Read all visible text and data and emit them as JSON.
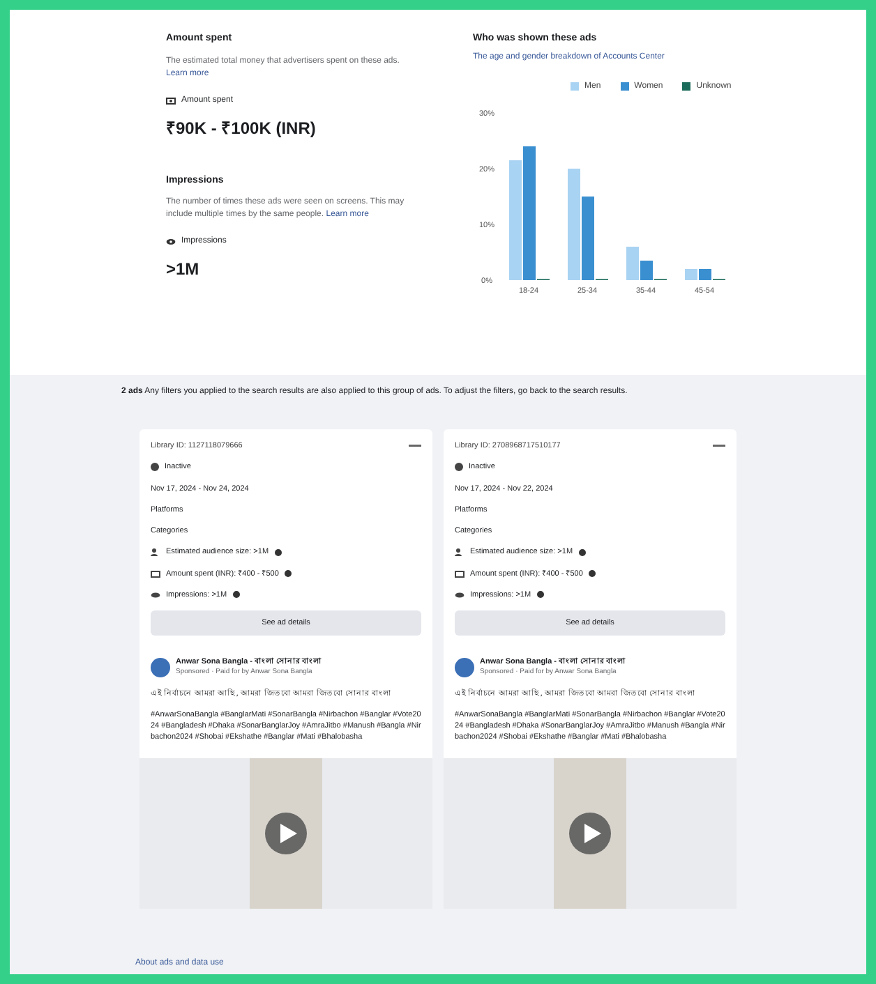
{
  "spend": {
    "title": "Amount spent",
    "description": "The estimated total money that advertisers spent on these ads.",
    "link": "Learn more",
    "label": "Amount spent",
    "value": "₹90K - ₹100K (INR)"
  },
  "impressions": {
    "title": "Impressions",
    "description": "The number of times these ads were seen on screens. This may include multiple times by the same people.",
    "link": "Learn more",
    "label": "Impressions",
    "value": ">1M"
  },
  "audience": {
    "title": "Who was shown these ads",
    "description": "The age and gender breakdown of Accounts Center",
    "chart_data": {
      "type": "bar",
      "categories": [
        "18-24",
        "25-34",
        "35-44",
        "45-54"
      ],
      "series": [
        {
          "name": "Men",
          "color": "#a9d3f2",
          "values": [
            21.5,
            20,
            6,
            2
          ]
        },
        {
          "name": "Women",
          "color": "#3a8fd0",
          "values": [
            24,
            15,
            3.5,
            2
          ]
        },
        {
          "name": "Unknown",
          "color": "#1b6b5a",
          "values": [
            0,
            0,
            0,
            0
          ]
        }
      ],
      "ylim": [
        0,
        30
      ],
      "yticks": [
        {
          "value": 0,
          "label": "0%"
        },
        {
          "value": 10,
          "label": "10%"
        },
        {
          "value": 20,
          "label": "20%"
        },
        {
          "value": 30,
          "label": "30%"
        }
      ]
    }
  },
  "summary": {
    "count": "2 ads",
    "text": "Any filters you applied to the search results are also applied to this group of ads. To adjust the filters, go back to the search results."
  },
  "ads": [
    {
      "library_id": "Library ID: 1127118079666",
      "status": "Inactive",
      "dates": "Nov 17, 2024 - Nov 24, 2024",
      "platforms": "Platforms",
      "categories": "Categories",
      "audience": "Estimated audience size: >1M",
      "spent": "Amount spent (INR): ₹400 - ₹500",
      "impressions": "Impressions: >1M",
      "button": "See ad details",
      "advertiser": "Anwar Sona Bangla - বাংলা সোনার বাংলা",
      "sponsored": "Sponsored · Paid for by Anwar Sona Bangla",
      "headline": "এই নির্বাচনে আমরা আছি, আমরা জিতবো আমরা জিতবো সোনার বাংলা",
      "body": "#AnwarSonaBangla #BanglarMati #SonarBangla #Nirbachon #Banglar #Vote2024 #Bangladesh #Dhaka #SonarBanglarJoy #AmraJitbo #Manush #Bangla #Nirbachon2024 #Shobai #Ekshathe #Banglar #Mati #Bhalobasha"
    },
    {
      "library_id": "Library ID: 2708968717510177",
      "status": "Inactive",
      "dates": "Nov 17, 2024 - Nov 22, 2024",
      "platforms": "Platforms",
      "categories": "Categories",
      "audience": "Estimated audience size: >1M",
      "spent": "Amount spent (INR): ₹400 - ₹500",
      "impressions": "Impressions: >1M",
      "button": "See ad details",
      "advertiser": "Anwar Sona Bangla - বাংলা সোনার বাংলা",
      "sponsored": "Sponsored · Paid for by Anwar Sona Bangla",
      "headline": "এই নির্বাচনে আমরা আছি, আমরা জিতবো আমরা জিতবো সোনার বাংলা",
      "body": "#AnwarSonaBangla #BanglarMati #SonarBangla #Nirbachon #Banglar #Vote2024 #Bangladesh #Dhaka #SonarBanglarJoy #AmraJitbo #Manush #Bangla #Nirbachon2024 #Shobai #Ekshathe #Banglar #Mati #Bhalobasha"
    }
  ],
  "footer_link": "About ads and data use"
}
